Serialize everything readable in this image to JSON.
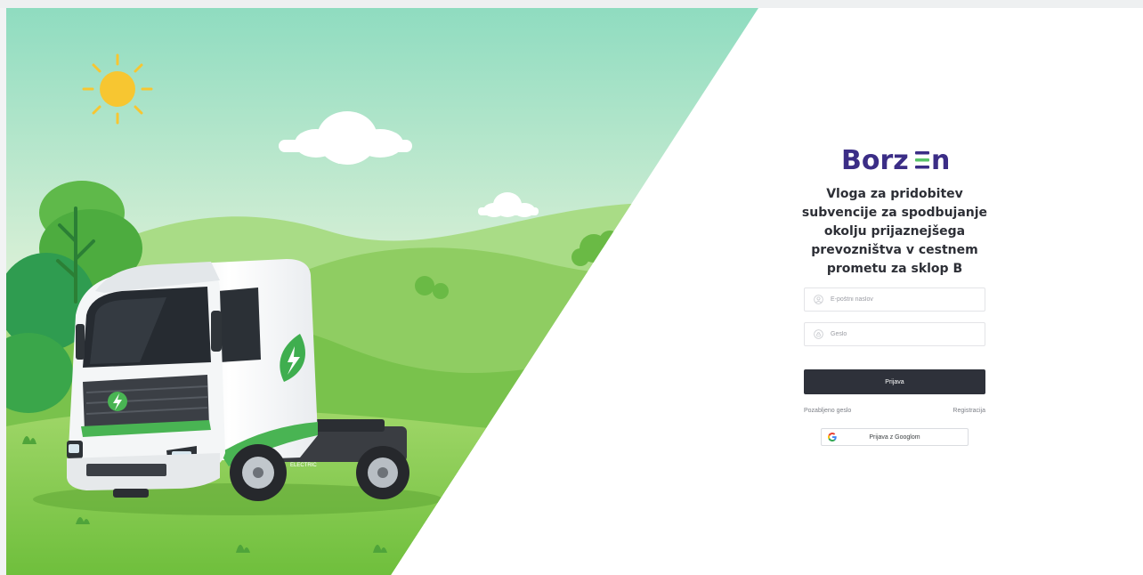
{
  "brand": {
    "logo_text": "Borzen",
    "color": "#3b2d86",
    "accent": "#58c36a"
  },
  "hero": {
    "truck_badge": "ELECTRIC",
    "theme": "electric-truck-green-hills"
  },
  "login": {
    "title": "Vloga za pridobitev subvencije za spodbujanje okolju prijaznejšega prevozništva v cestnem prometu za sklop B",
    "email_placeholder": "E-poštni naslov",
    "email_icon": "user-icon",
    "password_placeholder": "Geslo",
    "password_icon": "lock-icon",
    "submit_label": "Prijava",
    "forgot_label": "Pozabljeno geslo",
    "register_label": "Registracija",
    "google_label": "Prijava z Googlom",
    "google_icon": "google-icon"
  }
}
